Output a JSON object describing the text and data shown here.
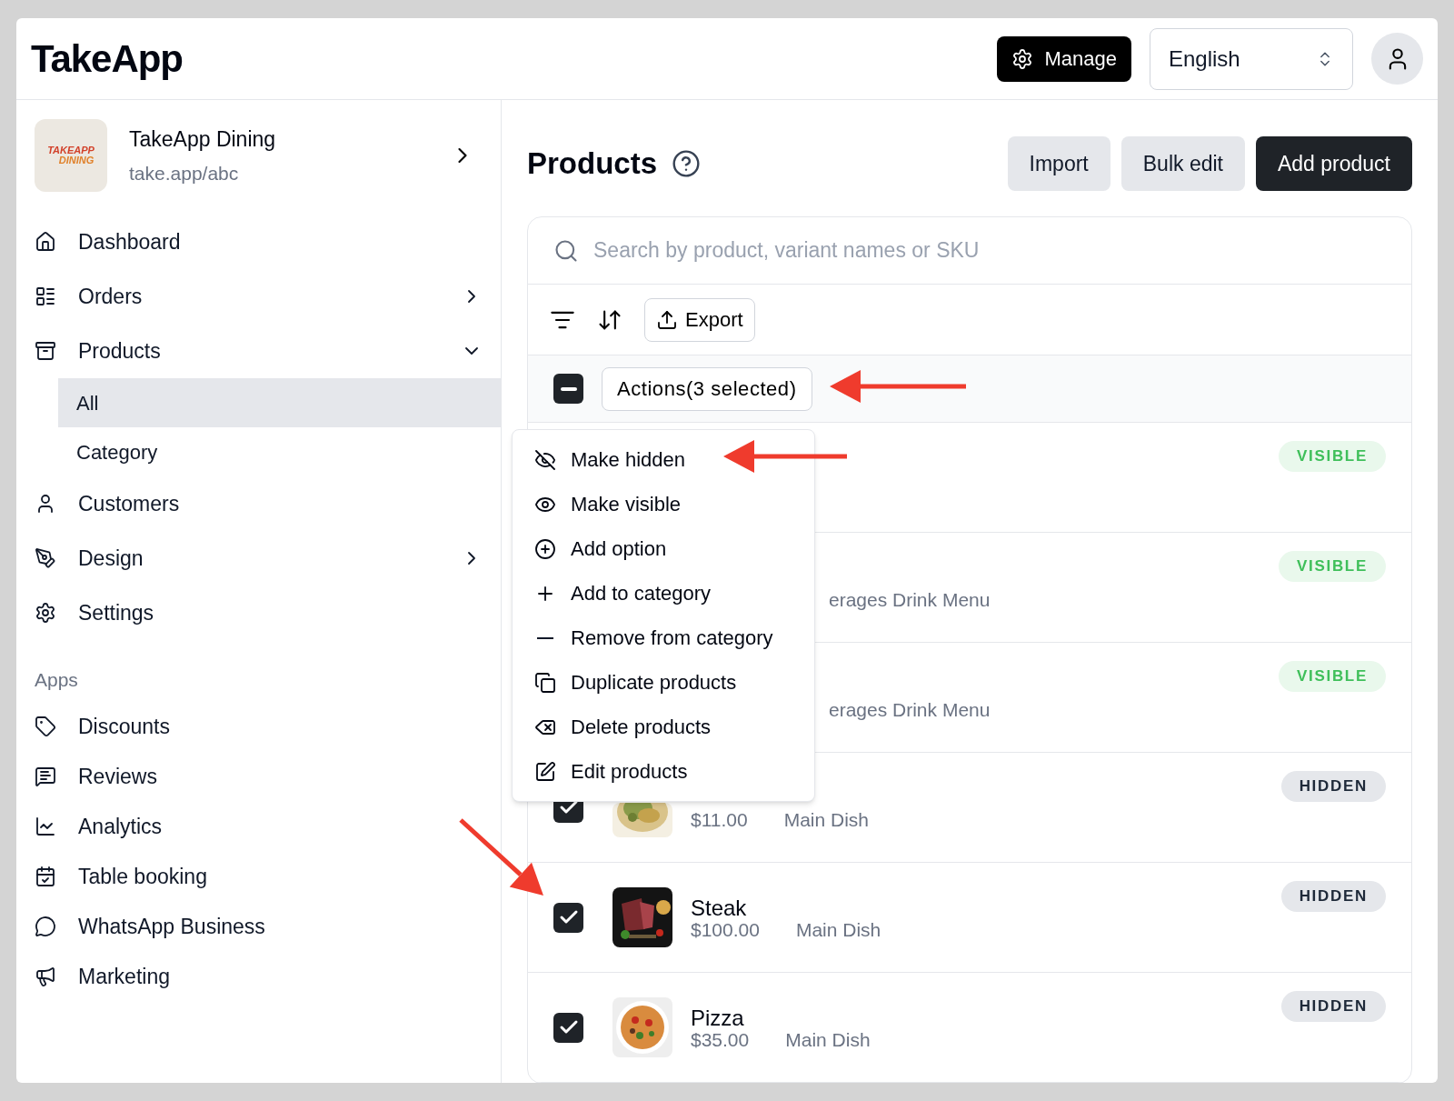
{
  "header": {
    "logo": "TakeApp",
    "manage_button": "Manage",
    "language": "English"
  },
  "store": {
    "logo_lines": [
      "TAKEAPP",
      "DINING"
    ],
    "name": "TakeApp Dining",
    "url": "take.app/abc"
  },
  "sidebar": {
    "items": [
      {
        "label": "Dashboard"
      },
      {
        "label": "Orders",
        "expanded": false
      },
      {
        "label": "Products",
        "expanded": true,
        "children": [
          {
            "label": "All",
            "selected": true
          },
          {
            "label": "Category",
            "selected": false
          }
        ]
      },
      {
        "label": "Customers"
      },
      {
        "label": "Design",
        "expanded": false
      },
      {
        "label": "Settings"
      }
    ],
    "apps_heading": "Apps",
    "apps": [
      {
        "label": "Discounts"
      },
      {
        "label": "Reviews"
      },
      {
        "label": "Analytics"
      },
      {
        "label": "Table booking"
      },
      {
        "label": "WhatsApp Business"
      },
      {
        "label": "Marketing"
      }
    ]
  },
  "main": {
    "title": "Products",
    "buttons": [
      {
        "label": "Import",
        "kind": "secondary"
      },
      {
        "label": "Bulk edit",
        "kind": "secondary"
      },
      {
        "label": "Add product",
        "kind": "primary"
      }
    ],
    "search": {
      "placeholder": "Search by product, variant names or SKU"
    },
    "export_button": "Export",
    "select_all": {
      "partial": true
    },
    "actions_button": "Actions(3 selected)",
    "actions_menu": [
      {
        "label": "Make hidden"
      },
      {
        "label": "Make visible"
      },
      {
        "label": "Add option"
      },
      {
        "label": "Add to category"
      },
      {
        "label": "Remove from category"
      },
      {
        "label": "Duplicate products"
      },
      {
        "label": "Delete products"
      },
      {
        "label": "Edit products"
      }
    ],
    "rows": [
      {
        "status": "VISIBLE",
        "visible": true
      },
      {
        "category": "erages Drink Menu",
        "status": "VISIBLE",
        "visible": true
      },
      {
        "category": "erages Drink Menu",
        "status": "VISIBLE",
        "visible": true
      },
      {
        "checked": true,
        "price": "$11.00",
        "category": "Main Dish",
        "status": "HIDDEN",
        "visible": false
      },
      {
        "checked": true,
        "name": "Steak",
        "price": "$100.00",
        "category": "Main Dish",
        "status": "HIDDEN",
        "visible": false
      },
      {
        "checked": true,
        "name": "Pizza",
        "price": "$35.00",
        "category": "Main Dish",
        "status": "HIDDEN",
        "visible": false
      }
    ]
  }
}
